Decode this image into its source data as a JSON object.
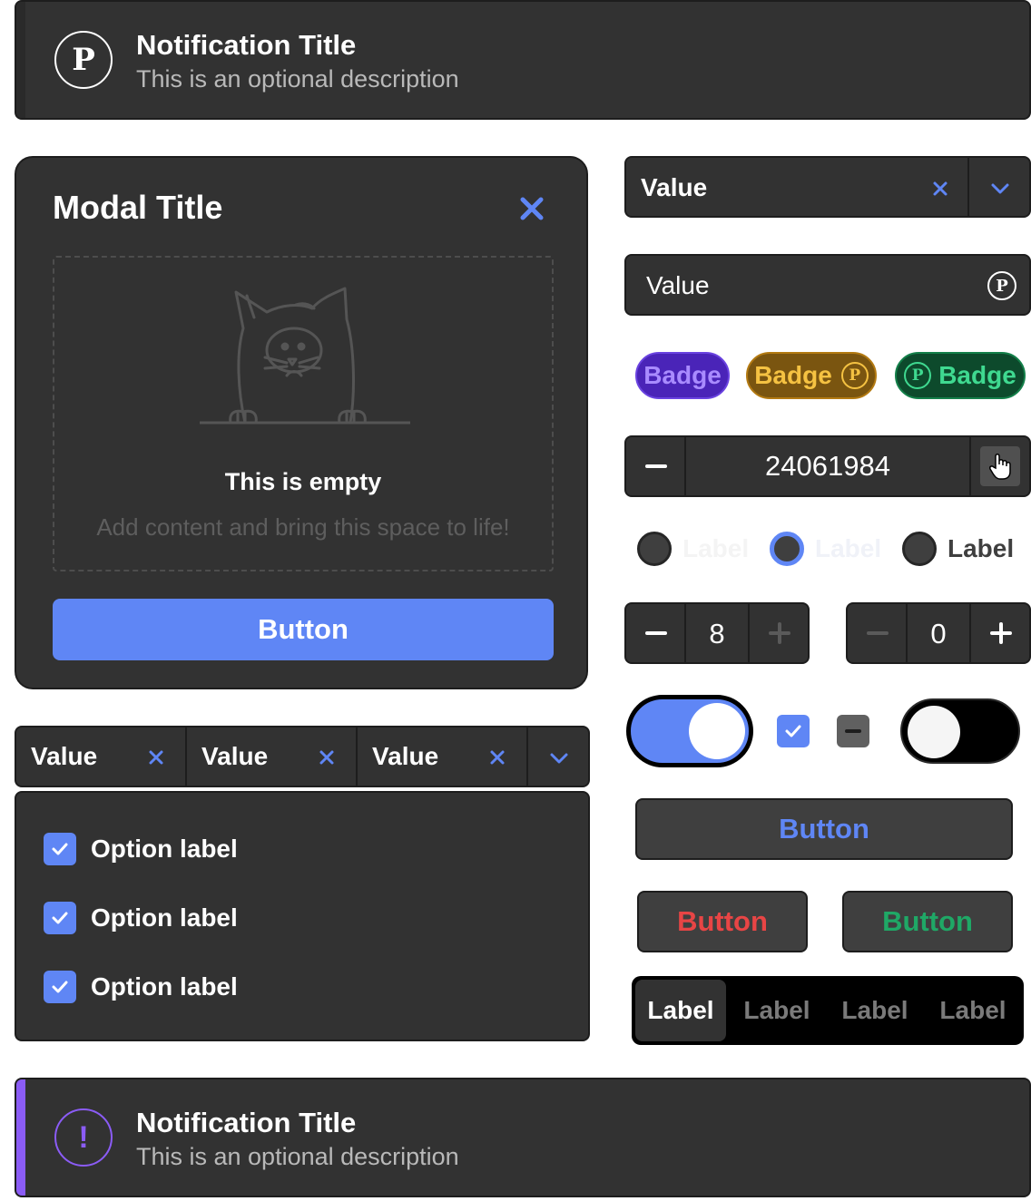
{
  "notification_top": {
    "icon": "p-circle-icon",
    "icon_glyph": "P",
    "title": "Notification Title",
    "description": "This is an optional description"
  },
  "modal": {
    "title": "Modal Title",
    "close_icon": "close-icon",
    "empty_title": "This is empty",
    "empty_description": "Add content and bring this space to life!",
    "button_label": "Button"
  },
  "multi_select": {
    "chips": [
      {
        "value": "Value"
      },
      {
        "value": "Value"
      },
      {
        "value": "Value"
      }
    ],
    "options": [
      {
        "label": "Option label",
        "checked": true
      },
      {
        "label": "Option label",
        "checked": true
      },
      {
        "label": "Option label",
        "checked": true
      }
    ]
  },
  "select": {
    "value": "Value"
  },
  "input": {
    "value": "Value",
    "icon": "p-circle-icon",
    "icon_glyph": "P"
  },
  "badges": [
    {
      "label": "Badge",
      "color": "#9b7bff",
      "bg": "#4a24b8",
      "icon": null
    },
    {
      "label": "Badge",
      "color": "#f5c242",
      "bg": "#7a5510",
      "icon_glyph": "P",
      "icon_position": "after"
    },
    {
      "label": "Badge",
      "color": "#3fd990",
      "bg": "#0d4a2c",
      "icon_glyph": "P",
      "icon_position": "before"
    }
  ],
  "number_stepper": {
    "value": "24061984"
  },
  "radios": [
    {
      "label": "Label",
      "state": "disabled"
    },
    {
      "label": "Label",
      "state": "focused"
    },
    {
      "label": "Label",
      "state": "default"
    }
  ],
  "small_steppers": [
    {
      "value": "8",
      "minus_enabled": true,
      "plus_enabled": false
    },
    {
      "value": "0",
      "minus_enabled": false,
      "plus_enabled": true
    }
  ],
  "toggles": {
    "toggle_on": true,
    "checkbox_checked": true,
    "checkbox_indeterminate": true,
    "toggle_off": false
  },
  "buttons": {
    "primary": {
      "label": "Button",
      "color": "#5f86f5"
    },
    "danger": {
      "label": "Button",
      "color": "#e84545"
    },
    "success": {
      "label": "Button",
      "color": "#1fa866"
    }
  },
  "segmented": {
    "items": [
      "Label",
      "Label",
      "Label",
      "Label"
    ],
    "selected": 0
  },
  "notification_bottom": {
    "icon": "exclamation-circle-icon",
    "icon_glyph": "!",
    "accent": "#8b5cf6",
    "title": "Notification Title",
    "description": "This is an optional description"
  },
  "colors": {
    "surface": "#323232",
    "accent_blue": "#5f86f5",
    "accent_purple": "#8b5cf6"
  }
}
